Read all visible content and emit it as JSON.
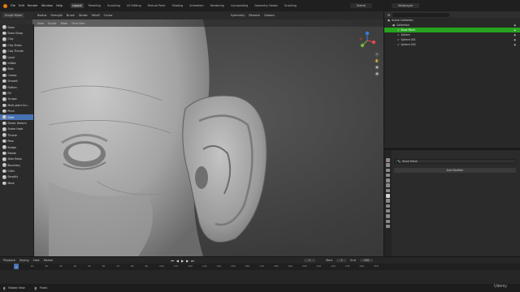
{
  "top_menu": [
    "File",
    "Edit",
    "Render",
    "Window",
    "Help"
  ],
  "workspaces": [
    "Layout",
    "Modeling",
    "Sculpting",
    "UV Editing",
    "Texture Paint",
    "Shading",
    "Animation",
    "Rendering",
    "Compositing",
    "Geometry Nodes",
    "Scripting"
  ],
  "active_workspace": "Layout",
  "scene_name": "Scene",
  "view_layer": "ViewLayer",
  "toolbar": {
    "mode": "Sculpt Mode",
    "radius_label": "Radius",
    "strength_label": "Strength",
    "brush_label": "Brush",
    "stroke_label": "Stroke",
    "falloff_label": "Falloff",
    "cursor_label": "Cursor",
    "symmetry_label": "Symmetry",
    "remesh_label": "Remesh",
    "options_label": "Options"
  },
  "viewport_header": [
    "View",
    "Sculpt",
    "Mask",
    "Face Sets"
  ],
  "brushes": [
    "Draw",
    "Draw Sharp",
    "Clay",
    "Clay Strips",
    "Clay Thumb",
    "Layer",
    "Inflate",
    "Blob",
    "Crease",
    "Smooth",
    "Flatten",
    "Fill",
    "Scrape",
    "Multi-plane Scr...",
    "Pinch",
    "Grab",
    "Elastic Deform",
    "Snake Hook",
    "Thumb",
    "Pose",
    "Nudge",
    "Rotate",
    "Slide Relax",
    "Boundary",
    "Cloth",
    "Simplify",
    "Mask"
  ],
  "active_brush": "Grab",
  "outliner": {
    "title": "Scene Collection",
    "rows": [
      {
        "label": "Collection",
        "indent": 1,
        "selected": false
      },
      {
        "label": "Brow Mesh",
        "indent": 2,
        "selected": true
      },
      {
        "label": "Sphere",
        "indent": 2,
        "selected": false
      },
      {
        "label": "Sphere.001",
        "indent": 2,
        "selected": false
      },
      {
        "label": "Sphere.002",
        "indent": 2,
        "selected": false
      }
    ]
  },
  "properties": {
    "object_name": "Brow Mesh",
    "add_modifier_label": "Add Modifier"
  },
  "timeline": {
    "controls": [
      "Playback",
      "Keying",
      "View",
      "Marker"
    ],
    "current_frame": "1",
    "start_label": "Start",
    "start": "1",
    "end_label": "End",
    "end": "250",
    "ticks": [
      "0",
      "10",
      "20",
      "30",
      "40",
      "50",
      "60",
      "70",
      "80",
      "90",
      "100",
      "110",
      "120",
      "130",
      "140",
      "150",
      "160",
      "170",
      "180",
      "190",
      "200",
      "210",
      "220",
      "230",
      "240",
      "250"
    ]
  },
  "status": {
    "left": "Rotate View",
    "right": "Fixed"
  },
  "branding": "Udemy",
  "colors": {
    "accent_blue": "#4772b3",
    "outliner_selected": "#26a31f",
    "axis_x": "#e0474f",
    "axis_y": "#7bb33b",
    "axis_z": "#3b7be0"
  }
}
